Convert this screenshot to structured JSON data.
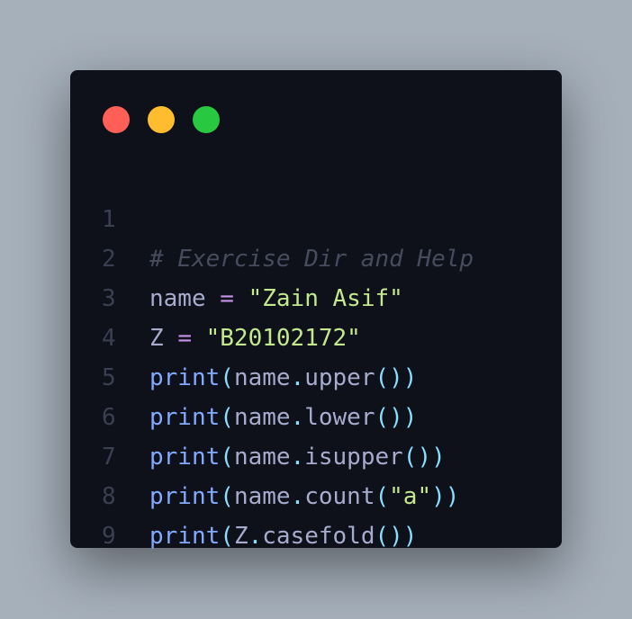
{
  "window": {
    "controls": {
      "close_color": "#ff5f57",
      "minimize_color": "#febc2e",
      "maximize_color": "#28c840"
    }
  },
  "code": {
    "line_numbers": [
      "1",
      "2",
      "3",
      "4",
      "5",
      "6",
      "7",
      "8",
      "9"
    ],
    "lines": [
      {
        "comment": "# Exercise Dir and Help"
      },
      {
        "ident": "name",
        "op": "=",
        "string": "\"Zain Asif\""
      },
      {
        "ident": "Z",
        "op": "=",
        "string": "\"B20102172\""
      },
      {
        "fn": "print",
        "obj": "name",
        "method": "upper"
      },
      {
        "fn": "print",
        "obj": "name",
        "method": "lower"
      },
      {
        "fn": "print",
        "obj": "name",
        "method": "isupper"
      },
      {
        "fn": "print",
        "obj": "name",
        "method": "count",
        "arg": "\"a\""
      },
      {
        "fn": "print",
        "obj": "Z",
        "method": "casefold"
      },
      {}
    ],
    "syntax_colors": {
      "comment": "#464b5d",
      "identifier": "#a6accd",
      "operator": "#c792ea",
      "string": "#c3e88d",
      "function": "#82aaff",
      "paren": "#89ddff"
    }
  }
}
